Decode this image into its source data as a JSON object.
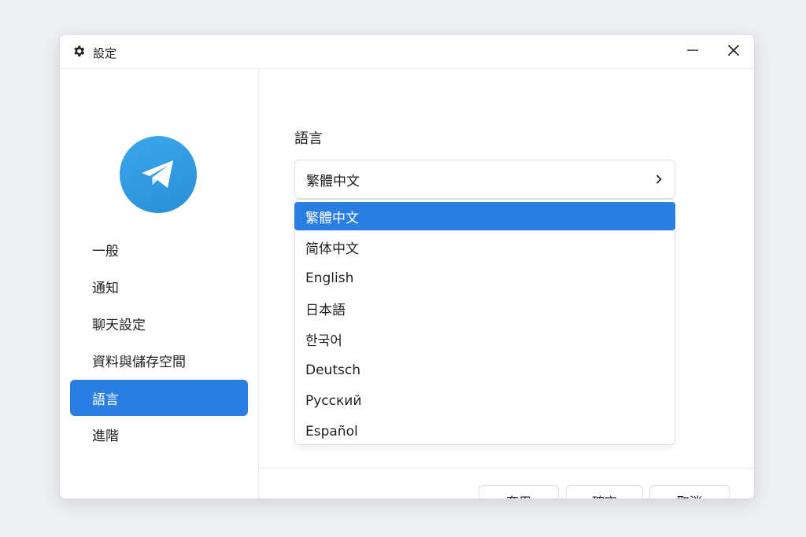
{
  "window": {
    "title": "設定",
    "icon": "gear-icon",
    "controls": [
      "minimize-icon",
      "close-icon"
    ]
  },
  "sidebar": {
    "logo": "telegram-logo",
    "items": [
      {
        "label": "一般",
        "active": false
      },
      {
        "label": "通知",
        "active": false
      },
      {
        "label": "聊天設定",
        "active": false
      },
      {
        "label": "資料與儲存空間",
        "active": false
      },
      {
        "label": "語言",
        "active": true
      },
      {
        "label": "進階",
        "active": false
      }
    ]
  },
  "main": {
    "section_title": "語言",
    "select": {
      "value": "繁體中文",
      "icon": "chevron-right-icon"
    },
    "options": [
      {
        "label": "繁體中文",
        "selected": true
      },
      {
        "label": "简体中文",
        "selected": false
      },
      {
        "label": "English",
        "selected": false
      },
      {
        "label": "日本語",
        "selected": false
      },
      {
        "label": "한국어",
        "selected": false
      },
      {
        "label": "Deutsch",
        "selected": false
      },
      {
        "label": "Русский",
        "selected": false
      },
      {
        "label": "Español",
        "selected": false
      }
    ]
  },
  "footer": {
    "apply_label": "套用",
    "ok_label": "確定",
    "cancel_label": "取消"
  },
  "colors": {
    "accent": "#2a7de1",
    "logo": "#2aa0e8",
    "background": "#eef0f3"
  }
}
